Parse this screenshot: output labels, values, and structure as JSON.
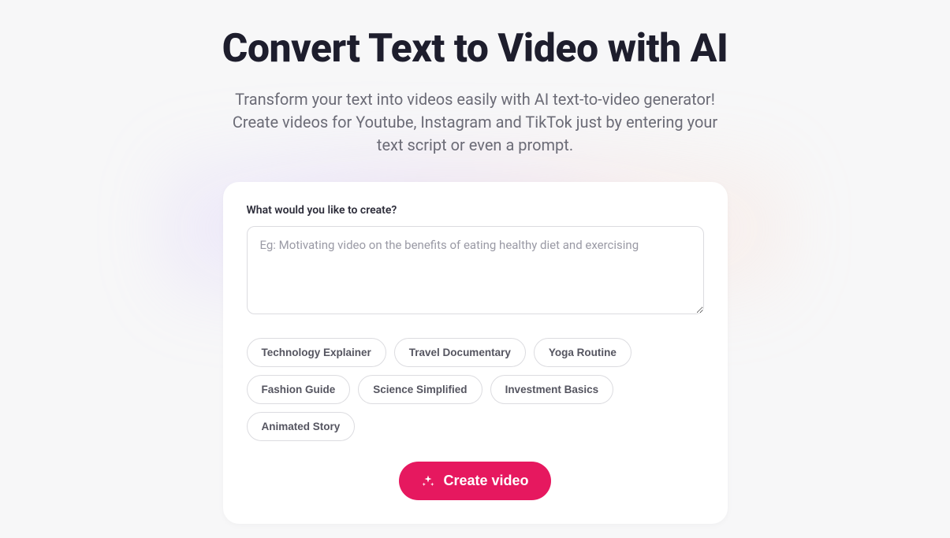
{
  "hero": {
    "title": "Convert Text to Video with AI",
    "subtitle": "Transform your text into videos easily with AI text-to-video generator! Create videos for Youtube, Instagram and TikTok just by entering your text script or even a prompt."
  },
  "form": {
    "label": "What would you like to create?",
    "placeholder": "Eg: Motivating video on the benefits of eating healthy diet and exercising",
    "value": ""
  },
  "suggestions": [
    "Technology Explainer",
    "Travel Documentary",
    "Yoga Routine",
    "Fashion Guide",
    "Science Simplified",
    "Investment Basics",
    "Animated Story"
  ],
  "actions": {
    "create_label": "Create video"
  }
}
